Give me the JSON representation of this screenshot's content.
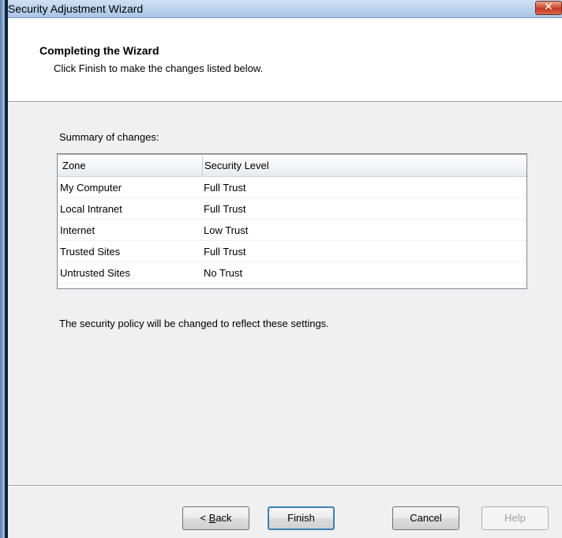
{
  "window": {
    "title": "Security Adjustment Wizard",
    "close_glyph": "✕"
  },
  "header": {
    "title": "Completing the Wizard",
    "subtitle": "Click Finish to make the changes listed below."
  },
  "summary": {
    "label": "Summary of changes:",
    "columns": [
      "Zone",
      "Security Level"
    ],
    "rows": [
      {
        "zone": "My Computer",
        "level": "Full Trust"
      },
      {
        "zone": "Local Intranet",
        "level": "Full Trust"
      },
      {
        "zone": "Internet",
        "level": "Low Trust"
      },
      {
        "zone": "Trusted Sites",
        "level": "Full Trust"
      },
      {
        "zone": "Untrusted Sites",
        "level": "No Trust"
      }
    ]
  },
  "policy_text": "The security policy will be changed to reflect these settings.",
  "buttons": {
    "back_prefix": "< ",
    "back_mnemonic": "B",
    "back_rest": "ack",
    "finish": "Finish",
    "cancel": "Cancel",
    "help": "Help"
  }
}
